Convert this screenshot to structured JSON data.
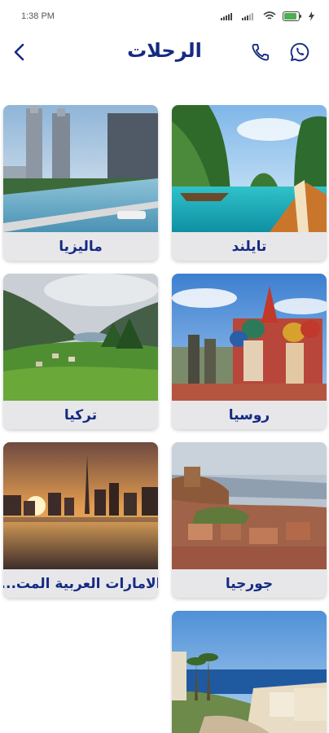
{
  "status_bar": {
    "time": "1:38 PM",
    "battery_color": "#4caf50"
  },
  "header": {
    "title": "الرحلات",
    "back_icon": "chevron-left-icon",
    "phone_icon": "phone-icon",
    "whatsapp_icon": "whatsapp-icon",
    "accent_color": "#152b82"
  },
  "destinations": [
    {
      "name": "تايلند",
      "image": "thailand-boat-island"
    },
    {
      "name": "ماليزيا",
      "image": "malaysia-infinity-pool-towers"
    },
    {
      "name": "روسيا",
      "image": "russia-saint-basil-cathedral"
    },
    {
      "name": "تركيا",
      "image": "turkey-green-valley-lake"
    },
    {
      "name": "جورجيا",
      "image": "georgia-tbilisi-old-town"
    },
    {
      "name": "الامارات العربية المت...",
      "image": "uae-dubai-skyline-sunset"
    },
    {
      "name": "",
      "image": "egypt-sharm-el-sheikh-coast"
    }
  ]
}
